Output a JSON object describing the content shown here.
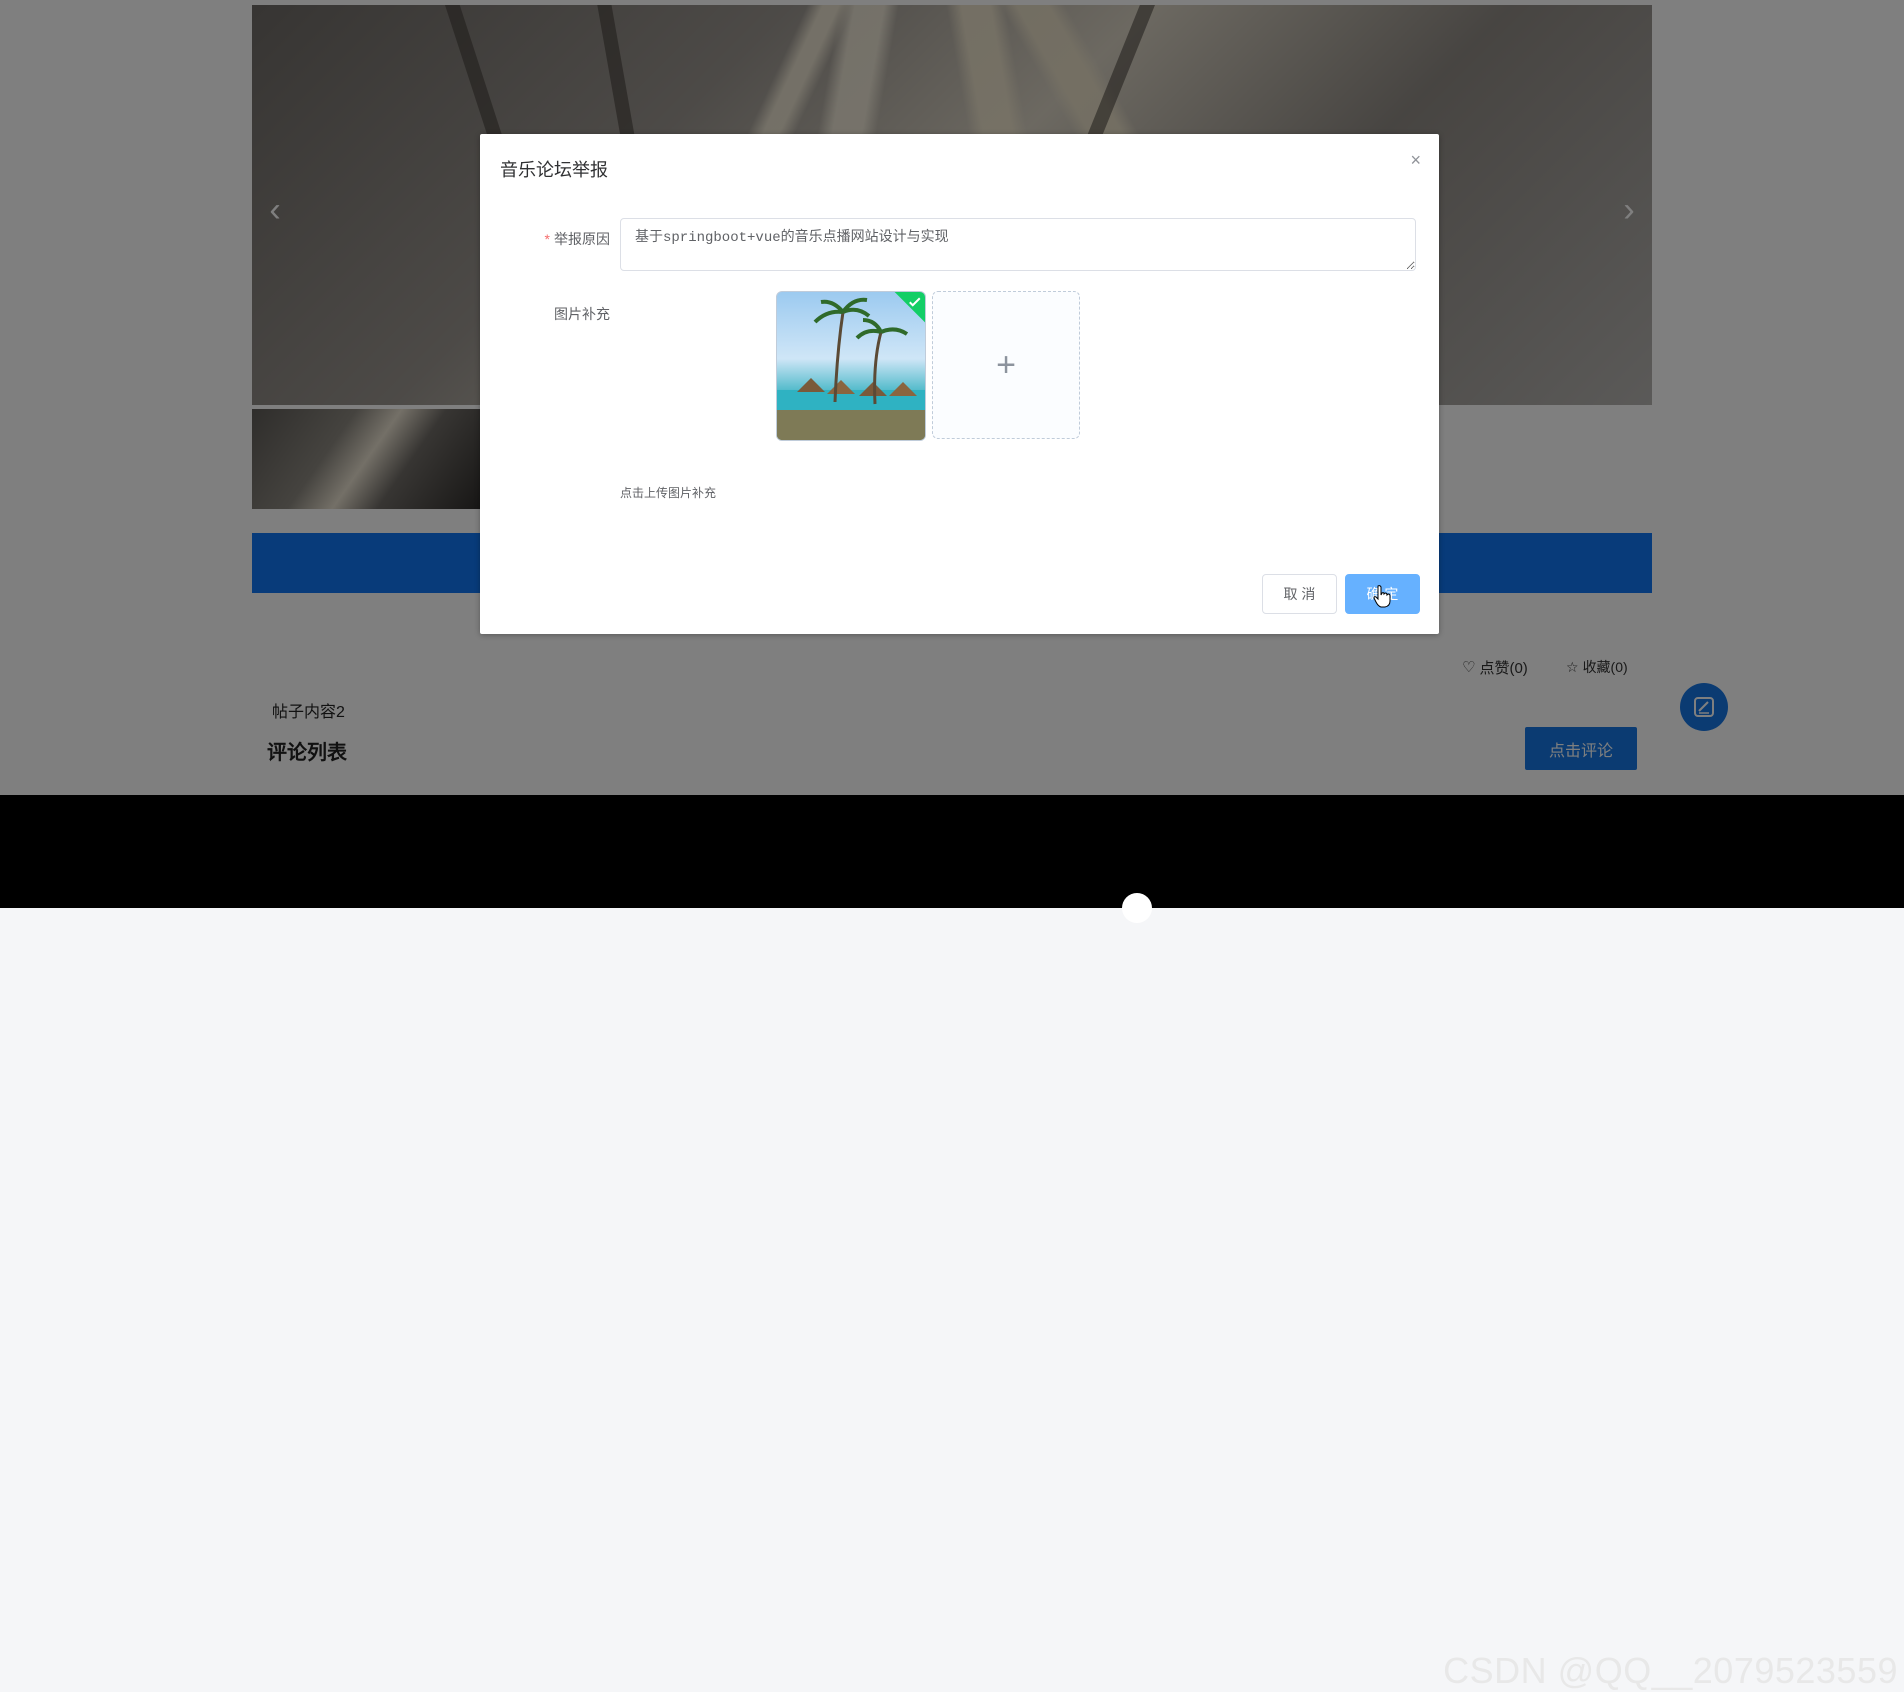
{
  "page": {
    "post_content": "帖子内容2",
    "comment_section_title": "评论列表",
    "comment_button": "点击评论",
    "like_label": "点赞(0)",
    "favorite_label": "收藏(0)",
    "watermark": "CSDN @QQ__2079523559"
  },
  "dialog": {
    "title": "音乐论坛举报",
    "reason_label": "举报原因",
    "reason_required_mark": "*",
    "reason_value": "基于springboot+vue的音乐点播网站设计与实现",
    "images_label": "图片补充",
    "upload_tip": "点击上传图片补充",
    "add_icon": "+",
    "close_icon": "×",
    "cancel_label": "取 消",
    "confirm_label": "确 定"
  },
  "colors": {
    "primary": "#1677e5",
    "primary_light": "#66b1ff",
    "success": "#13ce66",
    "danger": "#f56c6c"
  },
  "icons": [
    "chevron-left-icon",
    "chevron-right-icon",
    "heart-icon",
    "star-icon",
    "edit-icon",
    "close-icon",
    "plus-icon",
    "check-icon",
    "hand-cursor-icon"
  ]
}
